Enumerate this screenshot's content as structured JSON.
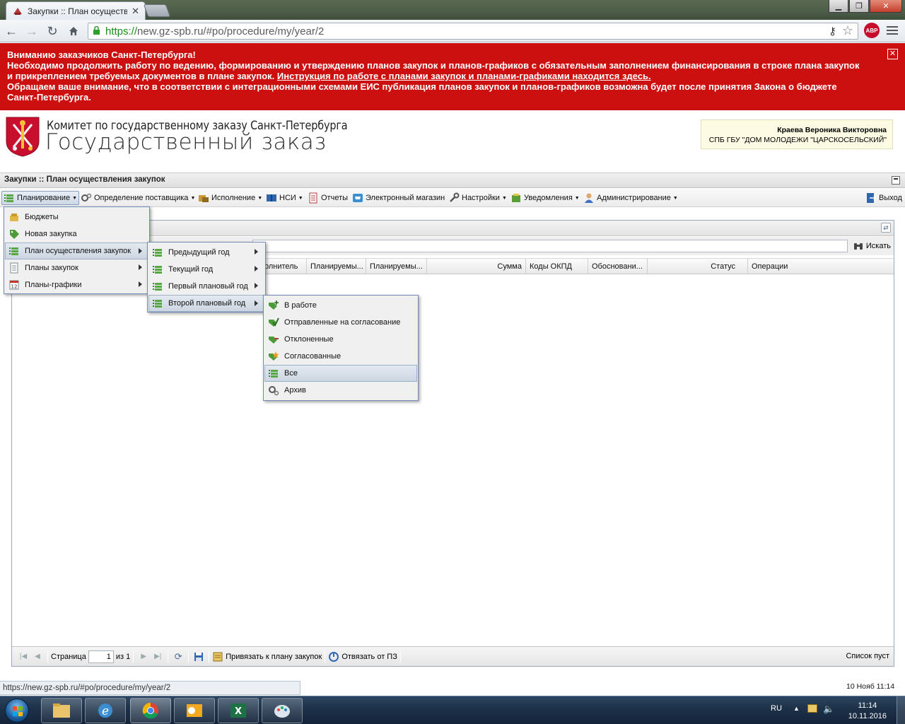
{
  "browser": {
    "tab_title": "Закупки :: План осуществ",
    "url_scheme": "https://",
    "url_rest": "new.gz-spb.ru/#po/procedure/my/year/2",
    "abp_label": "ABP"
  },
  "banner": {
    "line1": "Вниманию заказчиков Санкт-Петербурга!",
    "line2": "Необходимо продолжить работу по ведению, формированию и утверждению планов закупок и планов-графиков с обязательным заполнением финансирования в строке плана закупок и прикреплением требуемых документов в плане закупок. ",
    "link": "Инструкция по работе с планами закупок и планами-графиками находится здесь.",
    "line3": "Обращаем ваше внимание, что в соответствии с интеграционными схемами ЕИС публикация планов закупок и планов-графиков возможна будет после принятия Закона о бюджете Санкт-Петербурга.",
    "close": "✕"
  },
  "header": {
    "org_line1": "Комитет по государственному заказу Санкт-Петербурга",
    "org_line2": "Государственный заказ",
    "user_name": "Краева Вероника Викторовна",
    "user_org": "СПБ ГБУ \"ДОМ МОЛОДЕЖИ \"ЦАРСКОСЕЛЬСКИЙ\""
  },
  "panel": {
    "title": "Закупки :: План осуществления закупок"
  },
  "mainmenu": {
    "planning": "Планирование",
    "supplier": "Определение поставщика",
    "execution": "Исполнение",
    "nsi": "НСИ",
    "reports": "Отчеты",
    "eshop": "Электронный магазин",
    "settings": "Настройки",
    "notifications": "Уведомления",
    "admin": "Администрирование",
    "exit": "Выход"
  },
  "search": {
    "button": "Искать"
  },
  "columns": [
    "олнитель",
    "Планируемы...",
    "Планируемы...",
    "Сумма",
    "Коды ОКПД",
    "Обосновани...",
    "Статус",
    "Операции"
  ],
  "menu1": [
    "Бюджеты",
    "Новая закупка",
    "План осуществления закупок",
    "Планы закупок",
    "Планы-графики"
  ],
  "menu2": [
    "Предыдущий год",
    "Текущий год",
    "Первый плановый год",
    "Второй плановый год"
  ],
  "menu3": [
    "В работе",
    "Отправленные на согласование",
    "Отклоненные",
    "Согласованные",
    "Все",
    "Архив"
  ],
  "pager": {
    "page_label": "Страница",
    "page_value": "1",
    "of_label": "из 1",
    "bind_plan": "Привязать к плану закупок",
    "unbind": "Отвязать от ПЗ",
    "empty": "Список пуст"
  },
  "status": {
    "url": "https://new.gz-spb.ru/#po/procedure/my/year/2",
    "datetime": "10 Нояб 11:14"
  },
  "taskbar": {
    "lang": "RU",
    "time": "11:14",
    "date": "10.11.2016"
  },
  "colors": {
    "banner": "#cc0f0f",
    "menu_border": "#718bb7",
    "url_green": "#1a8d1a"
  }
}
